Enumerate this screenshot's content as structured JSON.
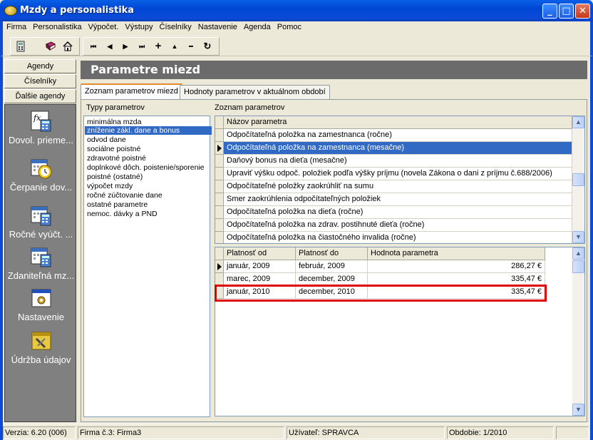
{
  "window": {
    "title": "Mzdy a personalistika",
    "minimize": "_",
    "maximize": "□",
    "close": "✕"
  },
  "menu": [
    "Firma",
    "Personalistika",
    "Výpočet.",
    "Výstupy",
    "Číselníky",
    "Nastavenie",
    "Agenda",
    "Pomoc"
  ],
  "toolbar": {
    "icons": [
      "calculator-icon",
      "book-icon",
      "home-icon",
      "first-record-icon",
      "prev-record-icon",
      "next-record-icon",
      "last-record-icon",
      "add-record-icon",
      "up-icon",
      "delete-record-icon",
      "refresh-icon"
    ],
    "nav_glyphs": [
      "⏮",
      "◀",
      "▶",
      "⏭",
      "+",
      "▲",
      "━",
      "↻"
    ]
  },
  "sidebar": {
    "tabs": [
      "Agendy",
      "Číselníky",
      "Ďalšie agendy"
    ],
    "items": [
      {
        "label": "Dovol. prieme...",
        "icon": "calculator-fx-icon"
      },
      {
        "label": "Čerpanie dov...",
        "icon": "calendar-clock-icon"
      },
      {
        "label": "Ročné vyúčt. ...",
        "icon": "calendar-calc-icon"
      },
      {
        "label": "Zdaniteľná mz...",
        "icon": "calendar-calc-icon"
      },
      {
        "label": "Nastavenie",
        "icon": "settings-window-icon"
      },
      {
        "label": "Údržba údajov",
        "icon": "maintenance-icon"
      }
    ]
  },
  "header": {
    "title": "Parametre miezd"
  },
  "tabs": [
    "Zoznam parametrov miezd",
    "Hodnoty parametrov v aktuálnom období"
  ],
  "types": {
    "label": "Typy parametrov",
    "items": [
      "minimálna mzda",
      "zníženie zákl. dane a bonus",
      "odvod dane",
      "sociálne poistné",
      "zdravotné poistné",
      "doplnkové dôch. poistenie/sporenie",
      "poistné (ostatné)",
      "výpočet mzdy",
      "ročné zúčtovanie dane",
      "ostatné parametre",
      "nemoc. dávky a PND"
    ],
    "selected_index": 1
  },
  "params": {
    "label": "Zoznam parametrov",
    "column": "Názov parametra",
    "rows": [
      "Odpočítateľná položka na zamestnanca (ročne)",
      "Odpočítateľná položka na zamestnanca (mesačne)",
      "Daňový bonus na dieťa (mesačne)",
      "Upraviť výšku odpoč. položiek podľa výšky príjmu (novela Zákona o dani z príjmu č.688/2006)",
      "Odpočítateľné položky zaokrúhliť na sumu",
      "Smer zaokrúhlenia odpočítateľných položiek",
      "Odpočítateľná položka na dieťa (ročne)",
      "Odpočítateľná položka na zdrav. postihnuté dieťa (ročne)",
      "Odpočítateľná položka na čiastočného invalida (ročne)"
    ],
    "selected_index": 1
  },
  "values": {
    "columns": [
      "Platnosť od",
      "Platnosť do",
      "Hodnota parametra"
    ],
    "rows": [
      [
        "január, 2009",
        "február, 2009",
        "286,27 €"
      ],
      [
        "marec, 2009",
        "december, 2009",
        "335,47 €"
      ],
      [
        "január, 2010",
        "december, 2010",
        "335,47 €"
      ]
    ],
    "current_index": 0,
    "highlighted_index": 2
  },
  "status": {
    "version": "Verzia: 6.20 (006)",
    "company": "Firma č.3: Firma3",
    "user": "Užívateľ: SPRAVCA",
    "period": "Obdobie: 1/2010"
  }
}
